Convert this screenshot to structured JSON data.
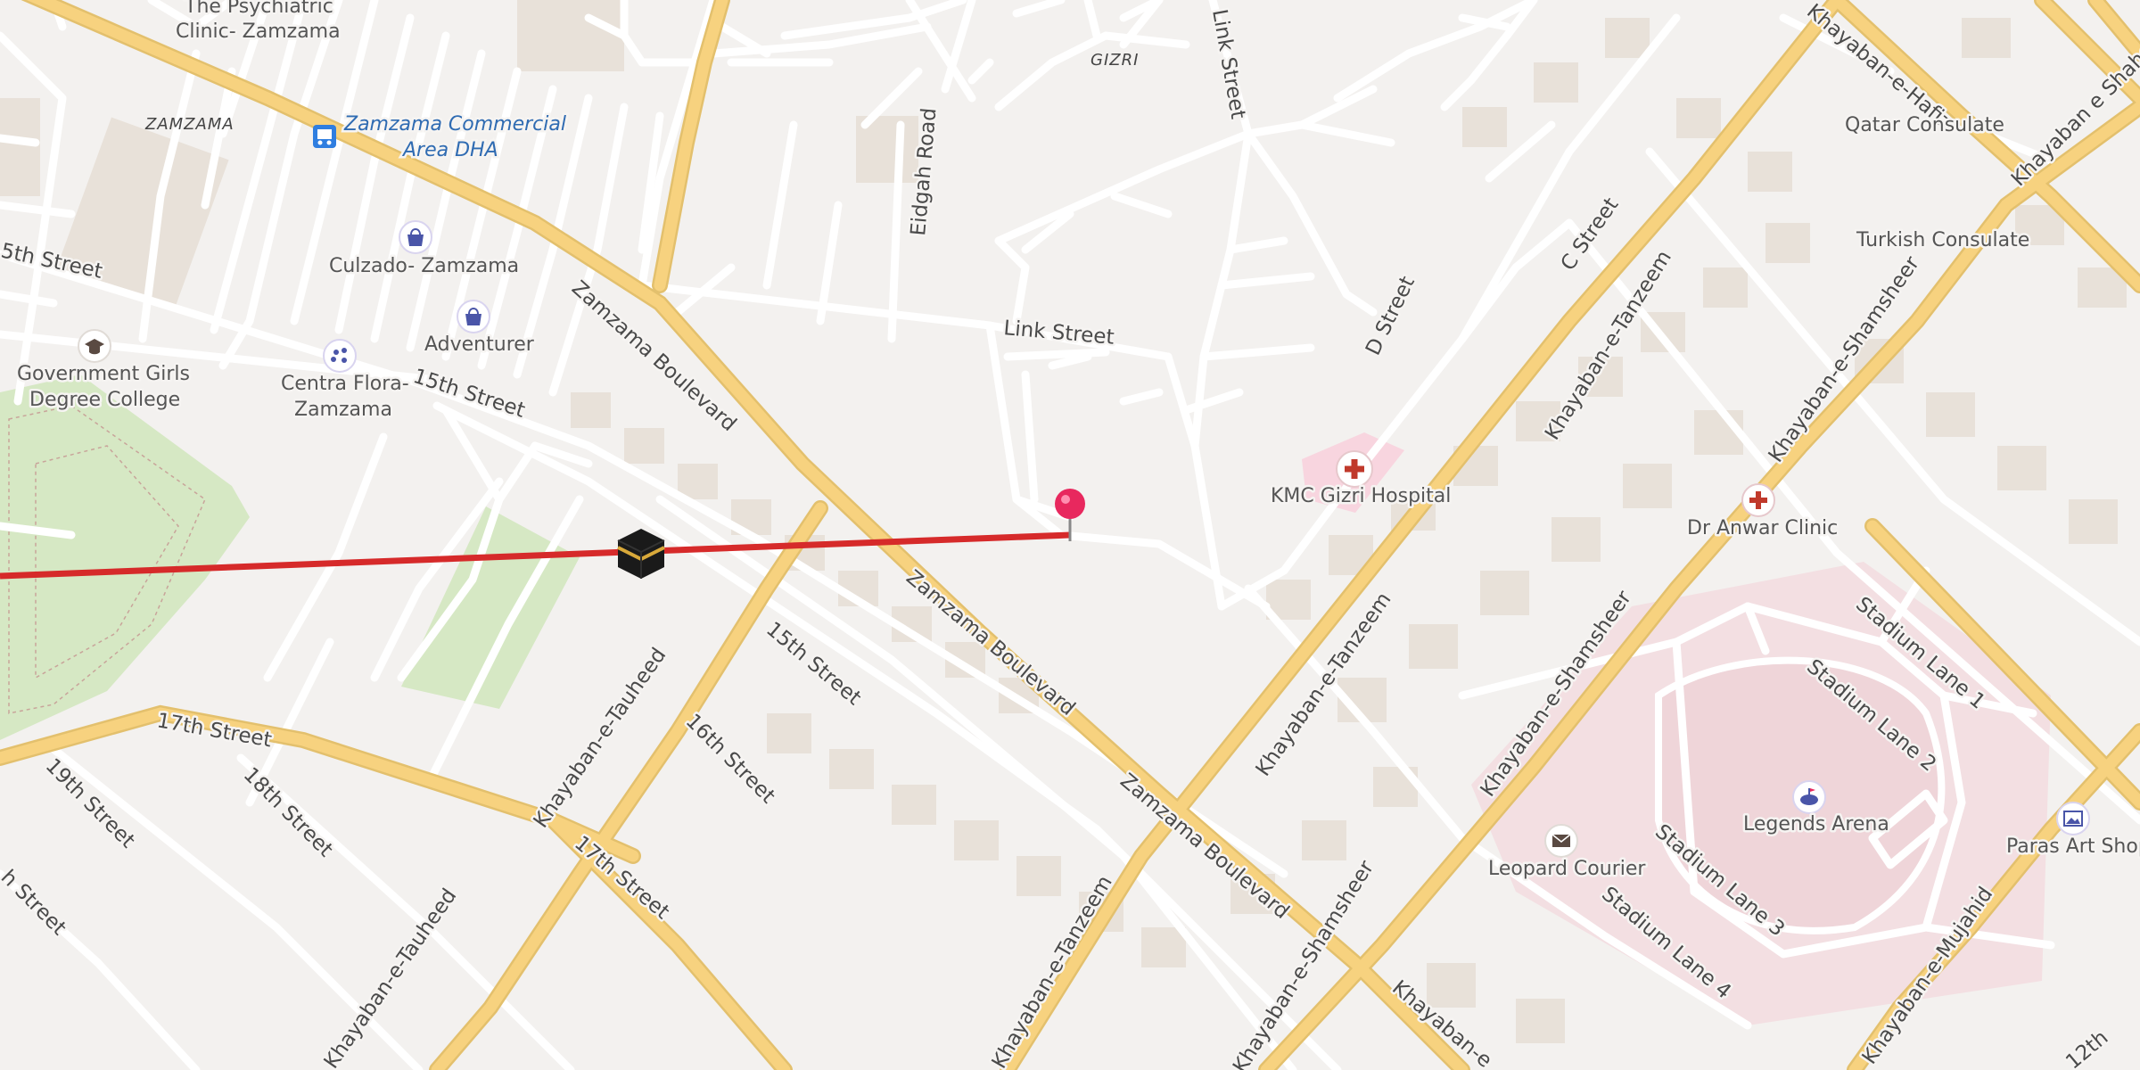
{
  "map": {
    "areas": {
      "zamzama": "ZAMZAMA",
      "gizri": "GIZRI"
    },
    "roads": {
      "zamzama_boulevard": "Zamzama Boulevard",
      "link_street": "Link Street",
      "eidgah_road": "Eidgah Road",
      "d_street": "D Street",
      "c_street": "C Street",
      "khayaban_tanzeem": "Khayaban-e-Tanzeem",
      "khayaban_shamsheer": "Khayaban-e-Shamsheer",
      "khayaban_hafiz": "Khayaban-e-Hafiz",
      "khayaban_shaheen": "Khayaban e Shaheen",
      "khayaban_tauheed": "Khayaban-e-Tauheed",
      "khayaban_mujahid": "Khayaban-e-Mujahid",
      "khayaban": "Khayaban-e",
      "street_5th": "5th Street",
      "street_15th": "15th Street",
      "street_16th": "16th Street",
      "street_17th": "17th Street",
      "street_18th": "18th Street",
      "street_19th": "19th Street",
      "street_12th": "12th",
      "street_h": "h Street",
      "stadium_lane_1": "Stadium Lane 1",
      "stadium_lane_2": "Stadium Lane 2",
      "stadium_lane_3": "Stadium Lane 3",
      "stadium_lane_4": "Stadium Lane 4"
    },
    "pois": {
      "psychiatric_1": "The Psychiatric",
      "psychiatric_2": "Clinic- Zamzama",
      "zamzama_commercial_1": "Zamzama Commercial",
      "zamzama_commercial_2": "Area DHA",
      "culzado": "Culzado- Zamzama",
      "adventurer": "Adventurer",
      "govt_college_1": "Government Girls",
      "govt_college_2": "Degree College",
      "centra_flora_1": "Centra Flora-",
      "centra_flora_2": "Zamzama",
      "kmc_hospital": "KMC Gizri Hospital",
      "dr_anwar": "Dr Anwar Clinic",
      "legends_arena": "Legends Arena",
      "leopard_courier": "Leopard Courier",
      "paras_art": "Paras Art Shop",
      "qatar_consulate": "Qatar Consulate",
      "turkish_consulate": "Turkish Consulate"
    },
    "icons": {
      "hospital": "hospital-icon",
      "clinic": "clinic-icon",
      "bus": "bus-stop-icon",
      "shop": "shopping-bag-icon",
      "school": "graduation-cap-icon",
      "florist": "flower-icon",
      "stadium": "stadium-icon",
      "post": "envelope-icon",
      "art": "picture-icon",
      "qibla": "kaaba-icon",
      "pin": "location-pin-icon"
    },
    "colors": {
      "background": "#f3f1ef",
      "major_road": "#f7d27f",
      "minor_road": "#ffffff",
      "building": "#e8e1d9",
      "park": "#d6e8c4",
      "stadium_area": "#f3dfe2",
      "route_line": "#d62a2a",
      "pin": "#e8285e",
      "poi_icon": "#4a55a8"
    }
  }
}
